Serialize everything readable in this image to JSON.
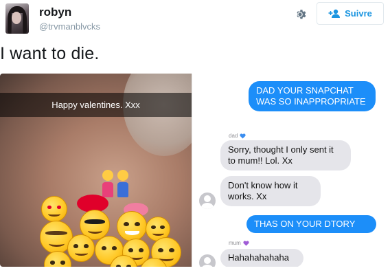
{
  "tweet": {
    "author_name": "robyn",
    "handle": "@trvmanblvcks",
    "follow_label": "Suivre",
    "text": "I want to die."
  },
  "icons": {
    "settings": "gear-icon",
    "follow": "add-user-icon"
  },
  "colors": {
    "follow_blue": "#1b95e0",
    "imessage_blue": "#1c8ef9",
    "imessage_gray": "#e5e5ea"
  },
  "snapchat": {
    "caption": "Happy valentines. Xxx"
  },
  "conversation": {
    "messages": [
      {
        "side": "sent",
        "text": "DAD YOUR SNAPCHAT WAS SO INAPPROPRIATE"
      },
      {
        "sender": "dad",
        "side": "received",
        "text": "Sorry, thought I only sent it to mum!! Lol. Xx"
      },
      {
        "side": "received",
        "text": "Don't know how it works. Xx"
      },
      {
        "side": "sent",
        "text": "THAS ON YOUR DTORY"
      },
      {
        "sender": "mum",
        "side": "received",
        "text": "Hahahahahaha"
      }
    ]
  }
}
